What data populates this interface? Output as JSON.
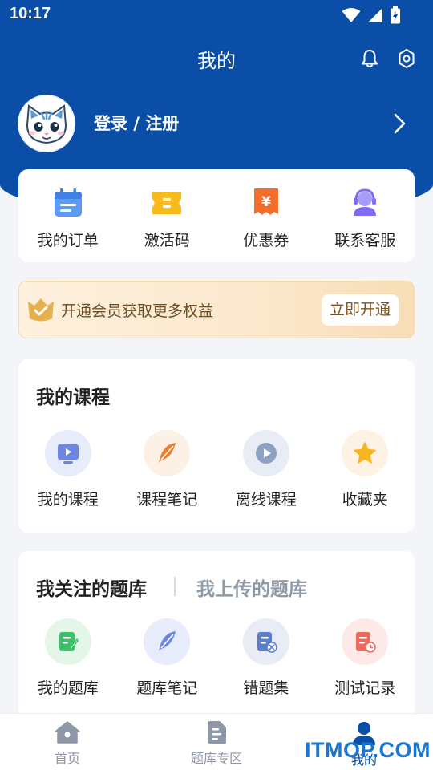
{
  "status_bar": {
    "time": "10:17"
  },
  "header": {
    "title": "我的"
  },
  "profile": {
    "login_label": "登录 / 注册"
  },
  "quick_actions": [
    {
      "label": "我的订单",
      "icon": "calendar-icon",
      "color": "#4c8ef7"
    },
    {
      "label": "激活码",
      "icon": "ticket-icon",
      "color": "#f6b21b"
    },
    {
      "label": "优惠券",
      "icon": "coupon-yen-icon",
      "color": "#f26b2a"
    },
    {
      "label": "联系客服",
      "icon": "customer-service-icon",
      "color": "#7a6cf0"
    }
  ],
  "vip_banner": {
    "text": "开通会员获取更多权益",
    "button": "立即开通"
  },
  "courses": {
    "title": "我的课程",
    "items": [
      {
        "label": "我的课程",
        "icon": "video-course-icon"
      },
      {
        "label": "课程笔记",
        "icon": "feather-icon"
      },
      {
        "label": "离线课程",
        "icon": "play-icon"
      },
      {
        "label": "收藏夹",
        "icon": "star-icon"
      }
    ]
  },
  "question_bank": {
    "tab_active": "我关注的题库",
    "tab_inactive": "我上传的题库",
    "items": [
      {
        "label": "我的题库",
        "icon": "edit-document-icon"
      },
      {
        "label": "题库笔记",
        "icon": "feather-icon"
      },
      {
        "label": "错题集",
        "icon": "wrong-answers-icon"
      },
      {
        "label": "测试记录",
        "icon": "test-record-icon"
      }
    ]
  },
  "bottom_nav": [
    {
      "label": "首页",
      "icon": "home-icon",
      "active": false
    },
    {
      "label": "题库专区",
      "icon": "document-icon",
      "active": false
    },
    {
      "label": "我的",
      "icon": "user-icon",
      "active": true
    }
  ],
  "watermark": "ITMOP.COM",
  "colors": {
    "primary": "#0a4ea8",
    "background": "#f3f5f8",
    "vip_gold": "#e7b04f"
  }
}
